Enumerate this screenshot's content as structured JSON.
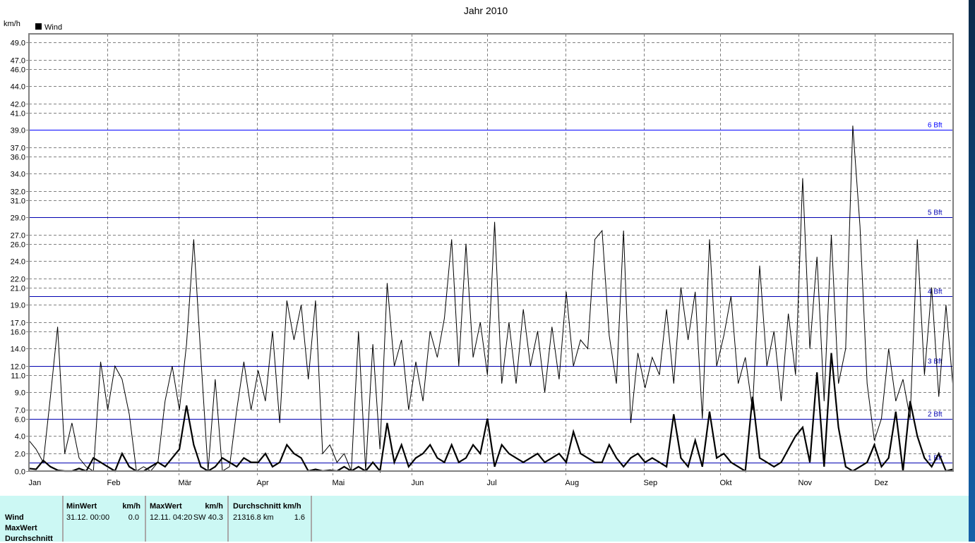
{
  "chart_data": {
    "type": "line",
    "title": "Jahr 2010",
    "ylabel": "km/h",
    "xlabel": "",
    "ylim": [
      0,
      50
    ],
    "xlim_days": [
      0,
      365
    ],
    "grid": true,
    "legend": {
      "placement": "top-left",
      "entries": [
        "Wind"
      ]
    },
    "yticks": [
      0.0,
      2.0,
      4.0,
      6.0,
      7.0,
      9.0,
      11.0,
      12.0,
      14.0,
      16.0,
      17.0,
      19.0,
      21.0,
      22.0,
      24.0,
      26.0,
      27.0,
      29.0,
      31.0,
      32.0,
      34.0,
      36.0,
      37.0,
      39.0,
      41.0,
      42.0,
      44.0,
      46.0,
      47.0,
      49.0
    ],
    "months": [
      {
        "label": "Jan",
        "day": 0
      },
      {
        "label": "Feb",
        "day": 31
      },
      {
        "label": "Mär",
        "day": 59
      },
      {
        "label": "Apr",
        "day": 90
      },
      {
        "label": "Mai",
        "day": 120
      },
      {
        "label": "Jun",
        "day": 151
      },
      {
        "label": "Jul",
        "day": 181
      },
      {
        "label": "Aug",
        "day": 212
      },
      {
        "label": "Sep",
        "day": 243
      },
      {
        "label": "Okt",
        "day": 273
      },
      {
        "label": "Nov",
        "day": 304
      },
      {
        "label": "Dez",
        "day": 334
      }
    ],
    "reference_lines": [
      {
        "label": "1 Bft",
        "value": 1.0,
        "color": "#0000b0"
      },
      {
        "label": "2 Bft",
        "value": 6.0,
        "color": "#0000b0"
      },
      {
        "label": "3 Bft",
        "value": 12.0,
        "color": "#0000b0"
      },
      {
        "label": "4 Bft",
        "value": 20.0,
        "color": "#0000b0"
      },
      {
        "label": "5 Bft",
        "value": 29.0,
        "color": "#0000b0"
      },
      {
        "label": "6 Bft",
        "value": 39.0,
        "color": "#0000ff"
      }
    ],
    "series": [
      {
        "name": "Wind (MaxWert)",
        "color": "#000000",
        "width": 1,
        "values": [
          3.5,
          2.5,
          1,
          8.5,
          16.5,
          2,
          5.5,
          1.5,
          0.5,
          0,
          12.5,
          7,
          12,
          10.5,
          6.5,
          0,
          0.5,
          0,
          1,
          8,
          12,
          7,
          14.5,
          26.5,
          13,
          0,
          10.5,
          0,
          0.5,
          7,
          12.5,
          7,
          11.5,
          8,
          16,
          5.5,
          19.5,
          15,
          19,
          10.5,
          19.5,
          2,
          3,
          1,
          2,
          0,
          16,
          0,
          14.5,
          2.5,
          21.5,
          12,
          15,
          7,
          12.5,
          8,
          16,
          13,
          17.5,
          26.5,
          12,
          26,
          13,
          17,
          11,
          28.5,
          10,
          17,
          10,
          18.5,
          12,
          16,
          9,
          16.5,
          10.5,
          20.5,
          12,
          15,
          14,
          26.5,
          27.5,
          15.5,
          10,
          27.5,
          5.5,
          13.5,
          9.5,
          13,
          11,
          18.5,
          10,
          21,
          15,
          20.5,
          6,
          26.5,
          12,
          15.5,
          20,
          10,
          13,
          7,
          23.5,
          12,
          16,
          8,
          18,
          11,
          33.5,
          14,
          24.5,
          8,
          27,
          10,
          14,
          39.5,
          28,
          10,
          3.5,
          6,
          14,
          8,
          10.5,
          6,
          26.5,
          11,
          21,
          8.5,
          19,
          9.5
        ]
      },
      {
        "name": "Wind (Durchschnitt)",
        "color": "#000000",
        "width": 2.2,
        "values": [
          0.3,
          0.2,
          1.2,
          0.5,
          0.1,
          0,
          0,
          0.3,
          0,
          1.5,
          1,
          0.5,
          0,
          2,
          0.5,
          0,
          0,
          0.5,
          1,
          0.5,
          1.5,
          2.5,
          7.5,
          3,
          0.5,
          0,
          0.5,
          1.5,
          1,
          0.5,
          1.5,
          1,
          1,
          2,
          0.5,
          1,
          3,
          2,
          1.5,
          0,
          0.2,
          0,
          0.1,
          0,
          0.5,
          0,
          0.5,
          0,
          1,
          0,
          5.5,
          1,
          3,
          0.5,
          1.5,
          2,
          3,
          1.5,
          1,
          3,
          1,
          1.5,
          3,
          2,
          6,
          0.5,
          3,
          2,
          1.5,
          1,
          1.5,
          2,
          1,
          1.5,
          2,
          1,
          4.5,
          2,
          1.5,
          1,
          1,
          3,
          1.5,
          0.5,
          1.5,
          2,
          1,
          1.5,
          1,
          0.5,
          6.5,
          1.5,
          0.5,
          3.5,
          0.5,
          6.8,
          1.5,
          2,
          1,
          0.5,
          0,
          8.5,
          1.5,
          1,
          0.5,
          1,
          2.5,
          4,
          5,
          1,
          11.3,
          0.5,
          13.5,
          5,
          0.5,
          0,
          0.5,
          1,
          3,
          0.5,
          1.5,
          6.8,
          0,
          8,
          4,
          1.5,
          0.5,
          2,
          0,
          0.2
        ]
      }
    ]
  },
  "stats": {
    "row_labels": [
      "Wind",
      "MaxWert",
      "Durchschnitt"
    ],
    "min": {
      "header": "MinWert",
      "unit": "km/h",
      "datetime": "31.12.  00:00",
      "value": "0.0"
    },
    "max": {
      "header": "MaxWert",
      "unit": "km/h",
      "datetime": "12.11.  04:20",
      "direction_value": "SW 40.3"
    },
    "avg": {
      "header": "Durchschnitt km/h",
      "distance": "21316.8 km",
      "value": "1.6"
    }
  }
}
